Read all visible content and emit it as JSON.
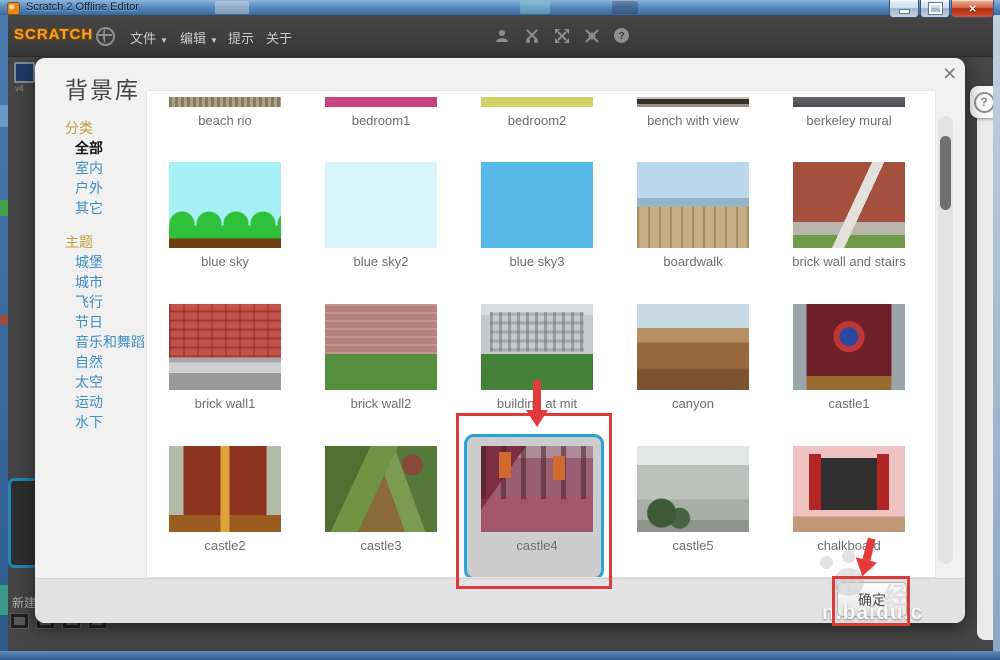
{
  "titlebar": {
    "title": "Scratch 2 Offline Editor"
  },
  "menubar": {
    "logo": "SCRATCH",
    "items": [
      {
        "label": "文件",
        "caret": "▼"
      },
      {
        "label": "编辑",
        "caret": "▼"
      },
      {
        "label": "提示",
        "caret": ""
      },
      {
        "label": "关于",
        "caret": ""
      }
    ]
  },
  "dialog": {
    "title": "背景库",
    "close_glyph": "×",
    "sidebar": {
      "sections": [
        {
          "header": "分类",
          "items": [
            {
              "label": "全部",
              "selected": true
            },
            {
              "label": "室内"
            },
            {
              "label": "户外"
            },
            {
              "label": "其它"
            }
          ]
        },
        {
          "header": "主题",
          "items": [
            {
              "label": "城堡"
            },
            {
              "label": "城市"
            },
            {
              "label": "飞行"
            },
            {
              "label": "节日"
            },
            {
              "label": "音乐和舞蹈"
            },
            {
              "label": "自然"
            },
            {
              "label": "太空"
            },
            {
              "label": "运动"
            },
            {
              "label": "水下"
            }
          ]
        }
      ]
    },
    "backdrops": {
      "row1": [
        "beach rio",
        "bedroom1",
        "bedroom2",
        "bench with view",
        "berkeley mural"
      ],
      "row2": [
        "blue sky",
        "blue sky2",
        "blue sky3",
        "boardwalk",
        "brick wall and stairs"
      ],
      "row3": [
        "brick wall1",
        "brick wall2",
        "building at mit",
        "canyon",
        "castle1"
      ],
      "row4": [
        "castle2",
        "castle3",
        "castle4",
        "castle5",
        "chalkboard"
      ]
    },
    "selected_backdrop": "castle4",
    "ok_label": "确定"
  },
  "background_app": {
    "new_backdrop_label": "新建",
    "version_label": "v4",
    "help_glyph": "?"
  },
  "watermark": {
    "big_text": "du",
    "logo_char": "经",
    "site_text": "n.baidu.c"
  },
  "colors": {
    "selection_blue": "#2aa4d8",
    "annotation_red": "#dc3b3b",
    "sidebar_header_gold": "#c79a3c",
    "sidebar_link_blue": "#3e8ec4",
    "titlebar_blue": "#5a8cc0",
    "menubar_gray": "#3d3d3d"
  }
}
